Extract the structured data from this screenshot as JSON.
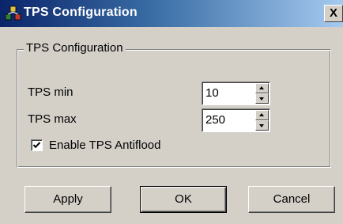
{
  "window": {
    "title": "TPS Configuration",
    "close_label": "X"
  },
  "icons": {
    "app": "network-icon",
    "close": "close-icon",
    "check": "checkmark-icon"
  },
  "group": {
    "legend": "TPS Configuration",
    "tps_min": {
      "label": "TPS  min",
      "value": "10"
    },
    "tps_max": {
      "label": "TPS max",
      "value": "250"
    },
    "antiflood": {
      "label": "Enable TPS Antiflood",
      "checked": true
    }
  },
  "buttons": {
    "apply": "Apply",
    "ok": "OK",
    "cancel": "Cancel"
  },
  "colors": {
    "face": "#d4d0c8",
    "title_start": "#0a246a",
    "title_end": "#a6caf0"
  }
}
